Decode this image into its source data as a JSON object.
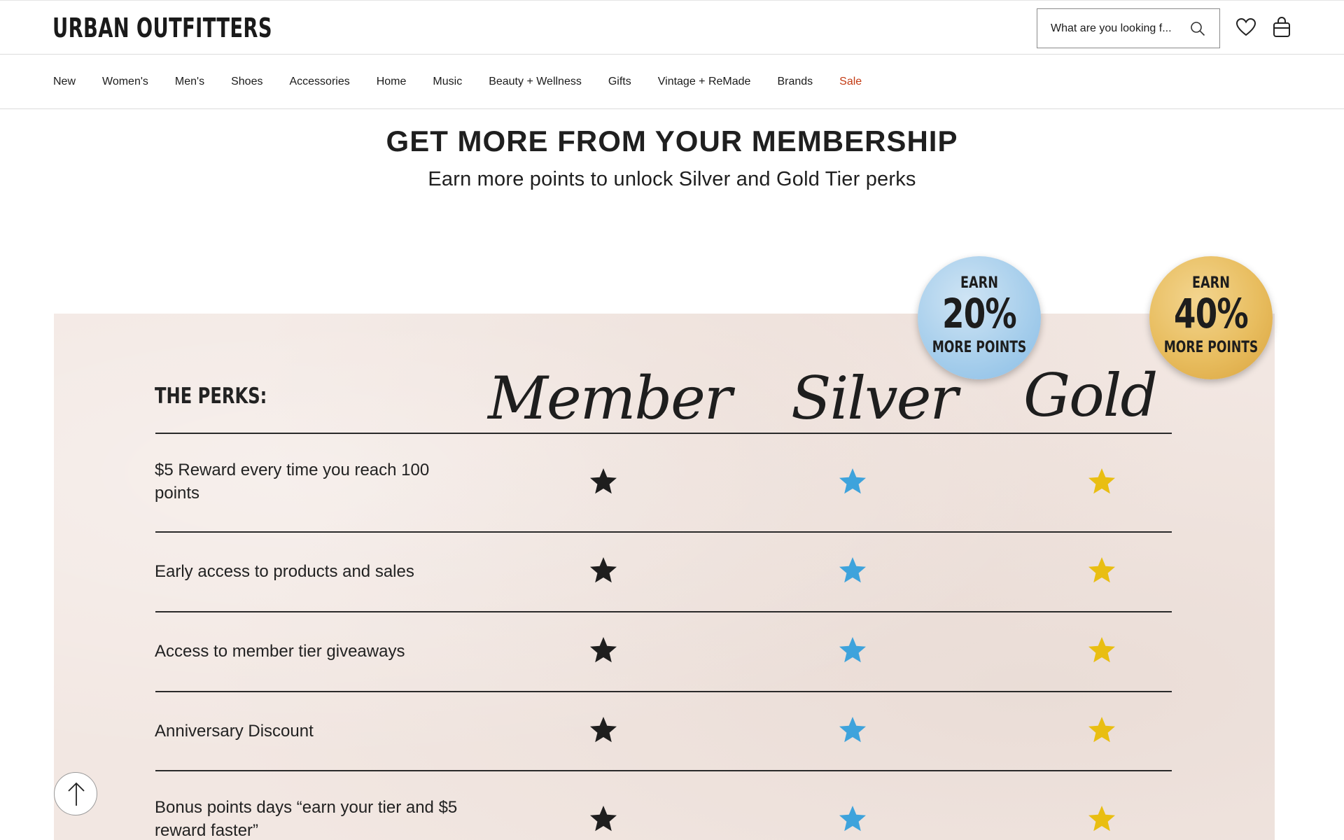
{
  "header": {
    "logo_text": "URBAN OUTFITTERS",
    "search_placeholder": "What are you looking f...",
    "icons": [
      "search-icon",
      "heart-icon",
      "shopping-bag-icon"
    ]
  },
  "nav": {
    "items": [
      {
        "label": "New"
      },
      {
        "label": "Women's"
      },
      {
        "label": "Men's"
      },
      {
        "label": "Shoes"
      },
      {
        "label": "Accessories"
      },
      {
        "label": "Home"
      },
      {
        "label": "Music"
      },
      {
        "label": "Beauty + Wellness"
      },
      {
        "label": "Gifts"
      },
      {
        "label": "Vintage + ReMade"
      },
      {
        "label": "Brands"
      },
      {
        "label": "Sale"
      }
    ],
    "sale_color": "#c33b14"
  },
  "hero": {
    "title": "GET MORE FROM YOUR MEMBERSHIP",
    "subtitle": "Earn more points to unlock Silver and Gold Tier perks"
  },
  "perks": {
    "heading": "THE PERKS:",
    "tiers": [
      {
        "name": "Member",
        "star_color": "#1e1e1e"
      },
      {
        "name": "Silver",
        "star_color": "#3ea3dc"
      },
      {
        "name": "Gold",
        "star_color": "#e9be12"
      }
    ],
    "badges": [
      {
        "line1": "EARN",
        "line2": "20%",
        "line3": "MORE POINTS"
      },
      {
        "line1": "EARN",
        "line2": "40%",
        "line3": "MORE POINTS"
      }
    ],
    "rows": [
      {
        "label": "$5 Reward every time you reach 100 points"
      },
      {
        "label": "Early access to products and sales"
      },
      {
        "label": "Access to member tier giveaways"
      },
      {
        "label": "Anniversary Discount"
      },
      {
        "label": "Bonus points days “earn your tier and $5 reward faster”"
      }
    ]
  },
  "controls": {
    "scroll_top_icon": "arrow-up-icon"
  }
}
